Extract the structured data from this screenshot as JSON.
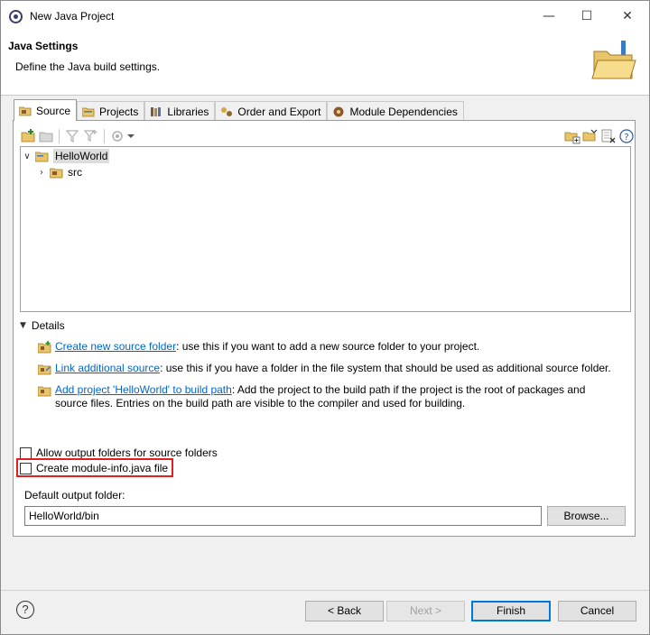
{
  "window": {
    "title": "New Java Project"
  },
  "titlebar_buttons": {
    "minimize": "—",
    "maximize": "☐",
    "close": "✕"
  },
  "header": {
    "title": "Java Settings",
    "description": "Define the Java build settings."
  },
  "tabs": [
    {
      "label": "Source",
      "icon": "source-folder-icon",
      "active": true
    },
    {
      "label": "Projects",
      "icon": "projects-icon"
    },
    {
      "label": "Libraries",
      "icon": "libraries-icon"
    },
    {
      "label": "Order and Export",
      "icon": "order-export-icon"
    },
    {
      "label": "Module Dependencies",
      "icon": "module-icon"
    }
  ],
  "tree": {
    "items": [
      {
        "label": "HelloWorld",
        "arrow": "∨",
        "selected": true
      },
      {
        "label": "src",
        "arrow": "›"
      }
    ]
  },
  "details": {
    "label": "Details",
    "arrow": "▼",
    "items": [
      {
        "link": "Create new source folder",
        "text": ": use this if you want to add a new source folder to your project."
      },
      {
        "link": "Link additional source",
        "text": ": use this if you have a folder in the file system that should be used as additional source folder."
      },
      {
        "link": "Add project 'HelloWorld' to build path",
        "text": ": Add the project to the build path if the project is the root of packages and source files. Entries on the build path are visible to the compiler and used for building."
      }
    ]
  },
  "options": {
    "allow_output_folders": {
      "label": "Allow output folders for source folders",
      "checked": false
    },
    "create_module_info": {
      "label": "Create module-info.java file",
      "checked": false
    }
  },
  "output": {
    "label": "Default output folder:",
    "value": "HelloWorld/bin",
    "browse_label": "Browse..."
  },
  "footer": {
    "help": "?",
    "back_label": "< Back",
    "next_label": "Next >",
    "finish_label": "Finish",
    "cancel_label": "Cancel"
  },
  "colors": {
    "link": "#0066cc",
    "highlight": "#e02020",
    "default_button": "#0078d7"
  }
}
